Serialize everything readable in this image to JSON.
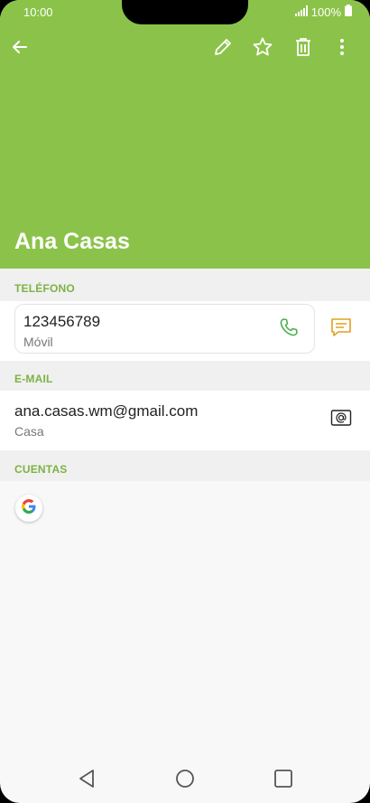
{
  "status_bar": {
    "time": "10:00",
    "battery": "100%",
    "signal_icon": "signal-icon",
    "battery_icon": "battery-icon"
  },
  "toolbar": {
    "back_icon": "back-arrow-icon",
    "edit_icon": "pencil-icon",
    "favorite_icon": "star-icon",
    "delete_icon": "trash-icon",
    "more_icon": "more-vert-icon"
  },
  "contact": {
    "name": "Ana Casas"
  },
  "sections": {
    "phone_label": "TELÉFONO",
    "email_label": "E-MAIL",
    "accounts_label": "CUENTAS"
  },
  "phone": {
    "number": "123456789",
    "type": "Móvil",
    "call_icon": "phone-icon",
    "message_icon": "message-icon"
  },
  "email": {
    "address": "ana.casas.wm@gmail.com",
    "type": "Casa",
    "email_icon": "email-at-icon"
  },
  "accounts": {
    "google_icon": "google-icon"
  },
  "colors": {
    "header": "#8bc34a",
    "section_label": "#7cb342",
    "call_icon": "#4caf50",
    "message_icon": "#e0a020"
  },
  "navbar": {
    "back_icon": "nav-back-icon",
    "home_icon": "nav-home-icon",
    "recents_icon": "nav-recents-icon"
  }
}
